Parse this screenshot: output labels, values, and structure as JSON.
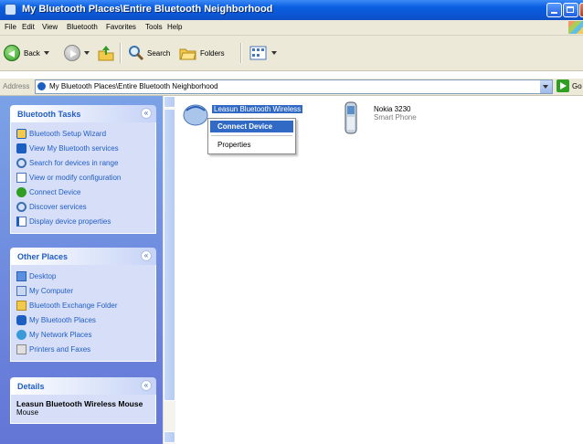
{
  "window": {
    "title": "My Bluetooth Places\\Entire Bluetooth Neighborhood"
  },
  "menubar": {
    "items": [
      "File",
      "Edit",
      "View",
      "Bluetooth",
      "Favorites",
      "Tools",
      "Help"
    ]
  },
  "toolbar": {
    "back": "Back",
    "search": "Search",
    "folders": "Folders"
  },
  "address": {
    "label": "Address",
    "value": "My Bluetooth Places\\Entire Bluetooth Neighborhood",
    "go": "Go"
  },
  "tasks": {
    "bluetooth": {
      "title": "Bluetooth Tasks",
      "items": [
        {
          "label": "Bluetooth Setup Wizard",
          "icon": "bluetooth-wizard-icon"
        },
        {
          "label": "View My Bluetooth services",
          "icon": "services-icon"
        },
        {
          "label": "Search for devices in range",
          "icon": "search-devices-icon"
        },
        {
          "label": "View or modify configuration",
          "icon": "configuration-icon"
        },
        {
          "label": "Connect Device",
          "icon": "connect-icon"
        },
        {
          "label": "Discover services",
          "icon": "discover-icon"
        },
        {
          "label": "Display device properties",
          "icon": "properties-icon"
        }
      ]
    },
    "other": {
      "title": "Other Places",
      "items": [
        {
          "label": "Desktop",
          "icon": "desktop-icon"
        },
        {
          "label": "My Computer",
          "icon": "computer-icon"
        },
        {
          "label": "Bluetooth Exchange Folder",
          "icon": "folder-icon"
        },
        {
          "label": "My Bluetooth Places",
          "icon": "bluetooth-places-icon"
        },
        {
          "label": "My Network Places",
          "icon": "network-icon"
        },
        {
          "label": "Printers and Faxes",
          "icon": "printer-icon"
        }
      ]
    },
    "details": {
      "title": "Details",
      "name": "Leasun Bluetooth Wireless Mouse",
      "type": "Mouse"
    }
  },
  "devices": [
    {
      "name": "Leasun Bluetooth Wireless",
      "type": "",
      "icon": "mouse-icon"
    },
    {
      "name": "Nokia 3230",
      "type": "Smart Phone",
      "icon": "phone-icon"
    }
  ],
  "context_menu": {
    "items": [
      "Connect Device",
      "Properties"
    ]
  }
}
